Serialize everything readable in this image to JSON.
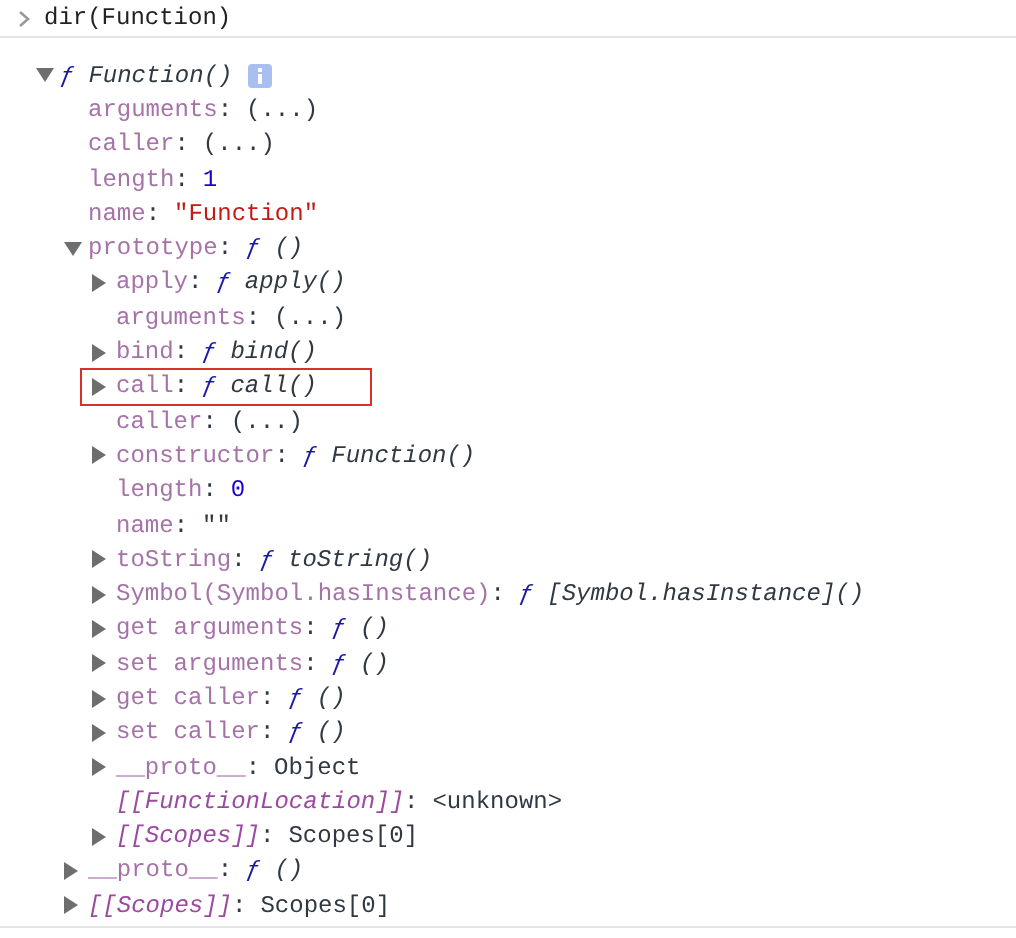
{
  "console": {
    "command": "dir(Function)",
    "tree": [
      {
        "value": "Function()",
        "prefix": "ƒ",
        "kind": "func",
        "info": true,
        "expanded": true,
        "highlighted": false,
        "children": [
          {
            "key": "arguments:",
            "internal": false,
            "value": "(...)",
            "kind": "plain",
            "highlighted": false
          },
          {
            "key": "caller:",
            "internal": false,
            "value": "(...)",
            "kind": "plain",
            "highlighted": false
          },
          {
            "key": "length:",
            "internal": false,
            "value": "1",
            "kind": "number",
            "highlighted": false
          },
          {
            "key": "name:",
            "internal": false,
            "value": "\"Function\"",
            "kind": "string",
            "highlighted": false
          },
          {
            "key": "prototype:",
            "internal": false,
            "prefix": "ƒ",
            "value": "()",
            "kind": "func",
            "expanded": true,
            "highlighted": false,
            "children": [
              {
                "key": "apply:",
                "internal": false,
                "prefix": "ƒ",
                "value": "apply()",
                "kind": "func",
                "expanded": false,
                "highlighted": false
              },
              {
                "key": "arguments:",
                "internal": false,
                "value": "(...)",
                "kind": "plain",
                "highlighted": false
              },
              {
                "key": "bind:",
                "internal": false,
                "prefix": "ƒ",
                "value": "bind()",
                "kind": "func",
                "expanded": false,
                "highlighted": false
              },
              {
                "key": "call:",
                "internal": false,
                "prefix": "ƒ",
                "value": "call()",
                "kind": "func",
                "expanded": false,
                "highlighted": true
              },
              {
                "key": "caller:",
                "internal": false,
                "value": "(...)",
                "kind": "plain",
                "highlighted": false
              },
              {
                "key": "constructor:",
                "internal": false,
                "prefix": "ƒ",
                "value": "Function()",
                "kind": "func",
                "expanded": false,
                "highlighted": false
              },
              {
                "key": "length:",
                "internal": false,
                "value": "0",
                "kind": "number",
                "highlighted": false
              },
              {
                "key": "name:",
                "internal": false,
                "value": "\"\"",
                "kind": "plain",
                "highlighted": false
              },
              {
                "key": "toString:",
                "internal": false,
                "prefix": "ƒ",
                "value": "toString()",
                "kind": "func",
                "expanded": false,
                "highlighted": false
              },
              {
                "key": "Symbol(Symbol.hasInstance):",
                "internal": false,
                "prefix": "ƒ",
                "value": "[Symbol.hasInstance]()",
                "kind": "func",
                "expanded": false,
                "highlighted": false
              },
              {
                "key": "get arguments:",
                "internal": false,
                "prefix": "ƒ",
                "value": "()",
                "kind": "func",
                "expanded": false,
                "highlighted": false
              },
              {
                "key": "set arguments:",
                "internal": false,
                "prefix": "ƒ",
                "value": "()",
                "kind": "func",
                "expanded": false,
                "highlighted": false
              },
              {
                "key": "get caller:",
                "internal": false,
                "prefix": "ƒ",
                "value": "()",
                "kind": "func",
                "expanded": false,
                "highlighted": false
              },
              {
                "key": "set caller:",
                "internal": false,
                "prefix": "ƒ",
                "value": "()",
                "kind": "func",
                "expanded": false,
                "highlighted": false
              },
              {
                "key": "__proto__:",
                "internal": false,
                "value": "Object",
                "kind": "plain",
                "expanded": false,
                "highlighted": false
              },
              {
                "key": "[[FunctionLocation]]:",
                "internal": true,
                "value": "<unknown>",
                "kind": "plain",
                "highlighted": false
              },
              {
                "key": "[[Scopes]]:",
                "internal": true,
                "value": "Scopes[0]",
                "kind": "plain",
                "expanded": false,
                "highlighted": false
              }
            ]
          },
          {
            "key": "__proto__:",
            "internal": false,
            "prefix": "ƒ",
            "value": "()",
            "kind": "func",
            "expanded": false,
            "highlighted": false
          },
          {
            "key": "[[Scopes]]:",
            "internal": true,
            "value": "Scopes[0]",
            "kind": "plain",
            "expanded": false,
            "highlighted": false
          }
        ]
      }
    ]
  }
}
